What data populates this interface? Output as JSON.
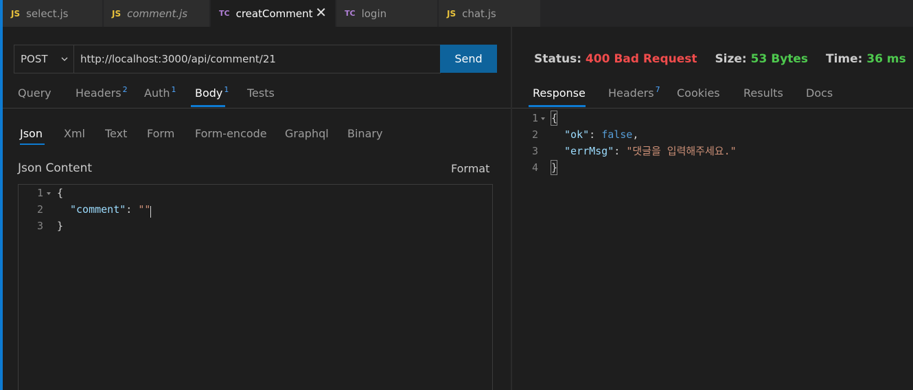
{
  "tabs": [
    {
      "icon": "JS",
      "label": "select.js"
    },
    {
      "icon": "JS",
      "label": "comment.js"
    },
    {
      "icon": "TC",
      "label": "creatComment"
    },
    {
      "icon": "TC",
      "label": "login"
    },
    {
      "icon": "JS",
      "label": "chat.js"
    }
  ],
  "active_tab": "creatComment",
  "request": {
    "method": "POST",
    "url": "http://localhost:3000/api/comment/21",
    "send_label": "Send",
    "tabs": {
      "query": "Query",
      "headers": "Headers",
      "headers_count": "2",
      "auth": "Auth",
      "auth_count": "1",
      "body": "Body",
      "body_count": "1",
      "tests": "Tests"
    },
    "active_tab": "Body",
    "body_types": [
      "Json",
      "Xml",
      "Text",
      "Form",
      "Form-encode",
      "Graphql",
      "Binary"
    ],
    "active_body_type": "Json",
    "content_title": "Json Content",
    "format_label": "Format",
    "code_lines": [
      {
        "no": "1",
        "parts": [
          "{"
        ]
      },
      {
        "no": "2",
        "key": "\"comment\"",
        "sep": ": ",
        "value": "\"\""
      },
      {
        "no": "3",
        "parts": [
          "}"
        ]
      }
    ]
  },
  "response": {
    "status_label": "Status:",
    "status_value": "400 Bad Request",
    "size_label": "Size:",
    "size_value": "53 Bytes",
    "time_label": "Time:",
    "time_value": "36 ms",
    "tabs": {
      "response": "Response",
      "headers": "Headers",
      "headers_count": "7",
      "cookies": "Cookies",
      "results": "Results",
      "docs": "Docs"
    },
    "active_tab": "Response",
    "code_lines": [
      {
        "no": "1",
        "text": "{"
      },
      {
        "no": "2",
        "key": "\"ok\"",
        "sep": ": ",
        "value": "false",
        "trail": ","
      },
      {
        "no": "3",
        "key": "\"errMsg\"",
        "sep": ": ",
        "value": "\"댓글을 입력해주세요.\""
      },
      {
        "no": "4",
        "text": "}"
      }
    ]
  },
  "colors": {
    "accent": "#0e7bd2",
    "send_button": "#0e639c",
    "status_error": "#f14c4c",
    "status_ok": "#4ec94e",
    "js_icon": "#e8c23c",
    "tc_icon": "#b180d7"
  }
}
